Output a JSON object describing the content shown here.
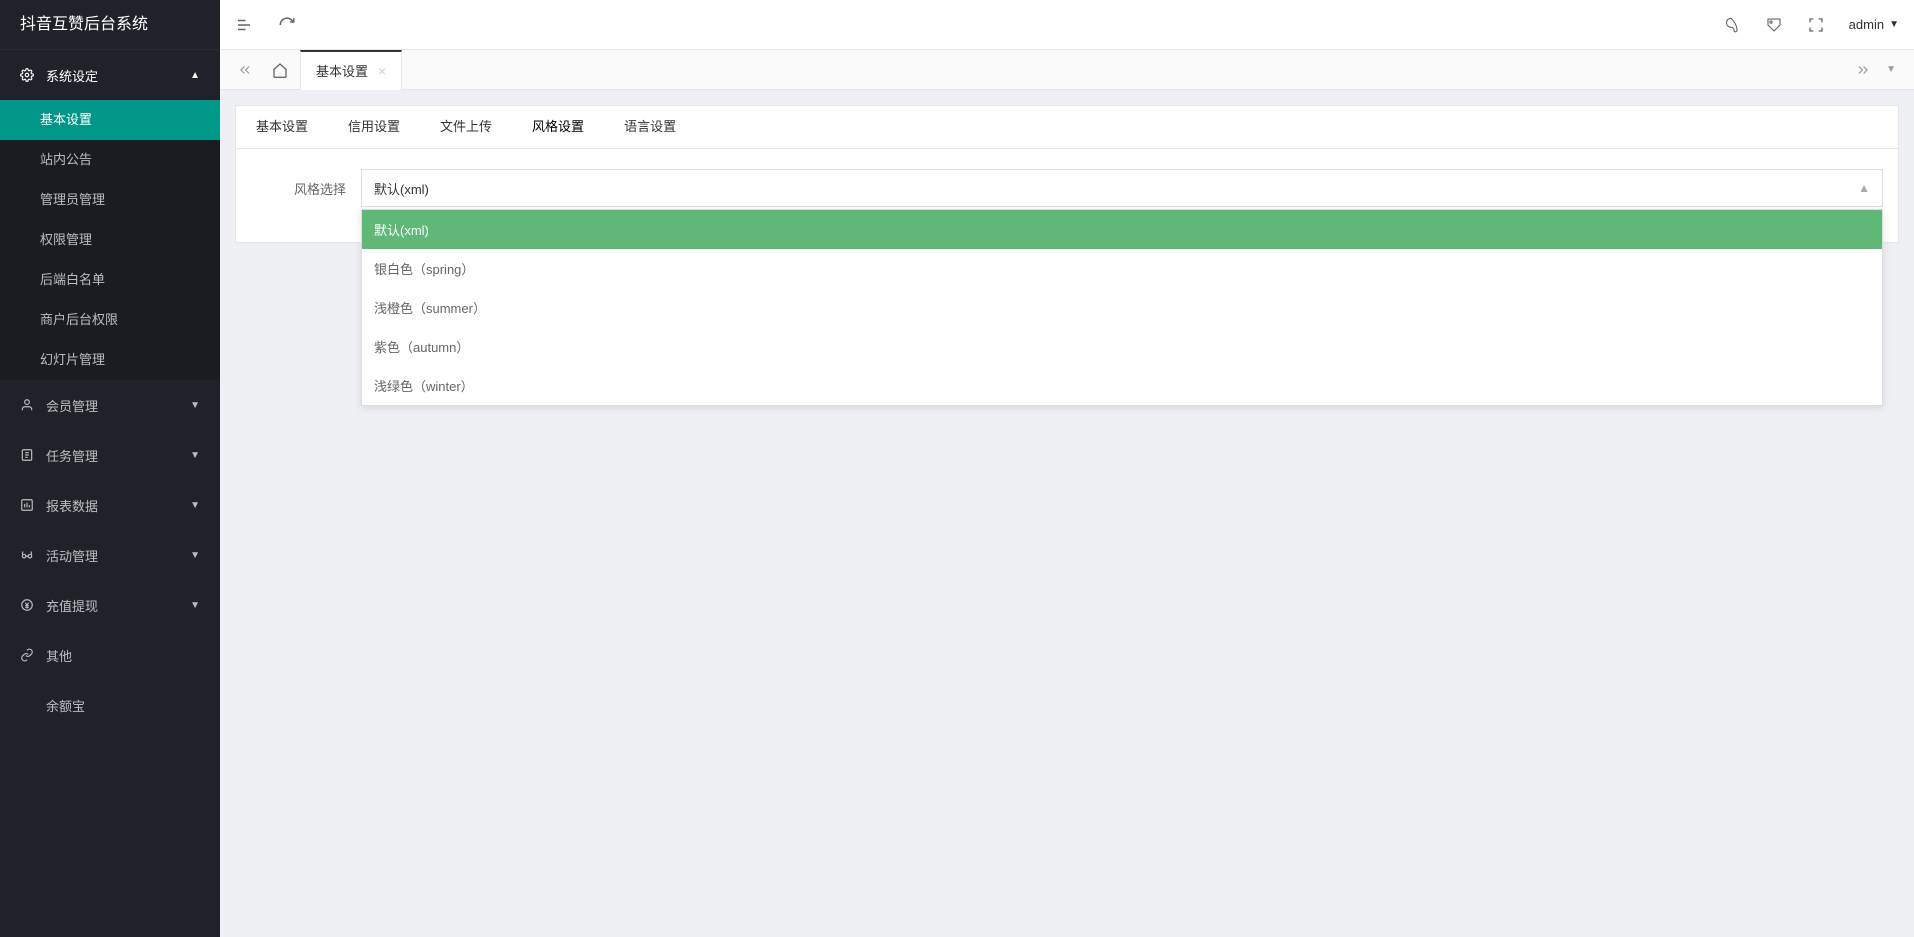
{
  "app": {
    "title": "抖音互赞后台系统"
  },
  "sidebar": {
    "sections": [
      {
        "label": "系统设定",
        "expanded": true,
        "children": [
          {
            "label": "基本设置",
            "active": true
          },
          {
            "label": "站内公告"
          },
          {
            "label": "管理员管理"
          },
          {
            "label": "权限管理"
          },
          {
            "label": "后端白名单"
          },
          {
            "label": "商户后台权限"
          },
          {
            "label": "幻灯片管理"
          }
        ]
      },
      {
        "label": "会员管理"
      },
      {
        "label": "任务管理"
      },
      {
        "label": "报表数据"
      },
      {
        "label": "活动管理"
      },
      {
        "label": "充值提现"
      },
      {
        "label": "其他"
      },
      {
        "label": "余额宝"
      }
    ]
  },
  "header": {
    "user": "admin"
  },
  "docTabs": {
    "active": "基本设置"
  },
  "contentTabs": [
    {
      "label": "基本设置"
    },
    {
      "label": "信用设置"
    },
    {
      "label": "文件上传"
    },
    {
      "label": "风格设置",
      "active": true
    },
    {
      "label": "语言设置"
    }
  ],
  "form": {
    "styleSelect": {
      "label": "风格选择",
      "value": "默认(xml)",
      "options": [
        "默认(xml)",
        "银白色（spring）",
        "浅橙色（summer）",
        "紫色（autumn）",
        "浅绿色（winter）"
      ]
    }
  }
}
